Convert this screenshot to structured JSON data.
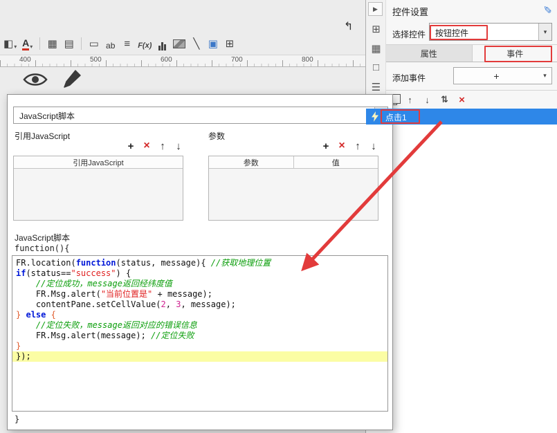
{
  "colors": {
    "accent_blue": "#2e87e8",
    "annotation_red": "#e23b3b",
    "highlight_yellow": "#fbfda4",
    "keyword_blue": "#0018d8",
    "string_red": "#e02020",
    "comment_green": "#0b9e0b"
  },
  "icons": {
    "caret_down": "▾",
    "collapse": "▶",
    "edit_pencil": "✎",
    "return_arrow": "↰"
  },
  "top_toolbar": {
    "icons": [
      {
        "name": "fill-color-icon",
        "glyph": "◧",
        "caret": true
      },
      {
        "name": "font-color-icon",
        "label": "A",
        "cls": "tb-fontA",
        "caret": true
      },
      {
        "name": "toolbar-separator",
        "type": "sep"
      },
      {
        "name": "merge-cell-icon",
        "glyph": "▦"
      },
      {
        "name": "unmerge-cell-icon",
        "glyph": "▤"
      },
      {
        "name": "toolbar-separator",
        "type": "sep"
      },
      {
        "name": "text-field-icon",
        "glyph": "▭"
      },
      {
        "name": "text-ab-icon",
        "label": "ab",
        "cls": "tb-ab"
      },
      {
        "name": "align-icon",
        "glyph": "≡"
      },
      {
        "name": "formula-icon",
        "label": "F(x)",
        "cls": "tb-fx"
      },
      {
        "name": "chart-icon",
        "type": "bars"
      },
      {
        "name": "image-icon",
        "type": "pic"
      },
      {
        "name": "line-icon",
        "glyph": "╲"
      },
      {
        "name": "panel-icon",
        "glyph": "▣",
        "cls": "tb-blue"
      },
      {
        "name": "widget-icon",
        "glyph": "⊞"
      }
    ]
  },
  "ruler": {
    "marks": [
      "400",
      "500",
      "600",
      "700",
      "800"
    ]
  },
  "dialog": {
    "type_value": "JavaScript脚本",
    "ref_label": "引用JavaScript",
    "param_label": "参数",
    "ref_table_header": "引用JavaScript",
    "param_col_name": "参数",
    "param_col_value": "值",
    "script_label": "JavaScript脚本",
    "func_open": "function(){",
    "func_close": "}",
    "toolbar_buttons": [
      {
        "name": "add-button",
        "glyph": "+"
      },
      {
        "name": "delete-button",
        "glyph": "×",
        "cls": "red"
      },
      {
        "name": "move-up-button",
        "glyph": "↑"
      },
      {
        "name": "move-down-button",
        "glyph": "↓"
      }
    ],
    "code_lines": [
      {
        "tokens": [
          {
            "t": "FR.location(",
            "c": "pl"
          },
          {
            "t": "function",
            "c": "kw"
          },
          {
            "t": "(status, message){ ",
            "c": "pl"
          },
          {
            "t": "//获取地理位置",
            "c": "cm"
          }
        ]
      },
      {
        "tokens": [
          {
            "t": "if",
            "c": "kw"
          },
          {
            "t": "(status==",
            "c": "pl"
          },
          {
            "t": "\"success\"",
            "c": "st"
          },
          {
            "t": ") {",
            "c": "pl"
          }
        ]
      },
      {
        "tokens": [
          {
            "t": "    ",
            "c": "pl"
          },
          {
            "t": "//定位成功，message返回经纬度值",
            "c": "cm"
          }
        ]
      },
      {
        "tokens": [
          {
            "t": "    FR.Msg.alert(",
            "c": "pl"
          },
          {
            "t": "\"当前位置是\"",
            "c": "st"
          },
          {
            "t": " + message);",
            "c": "pl"
          }
        ]
      },
      {
        "tokens": [
          {
            "t": "    contentPane.setCellValue(",
            "c": "pl"
          },
          {
            "t": "2",
            "c": "nm"
          },
          {
            "t": ", ",
            "c": "pl"
          },
          {
            "t": "3",
            "c": "nm"
          },
          {
            "t": ", message);",
            "c": "pl"
          }
        ]
      },
      {
        "tokens": [
          {
            "t": "}",
            "c": "br"
          },
          {
            "t": " ",
            "c": "pl"
          },
          {
            "t": "else",
            "c": "kw"
          },
          {
            "t": " ",
            "c": "pl"
          },
          {
            "t": "{",
            "c": "br"
          }
        ]
      },
      {
        "tokens": [
          {
            "t": "    ",
            "c": "pl"
          },
          {
            "t": "//定位失败，message返回对应的错误信息",
            "c": "cm"
          }
        ]
      },
      {
        "tokens": [
          {
            "t": "    FR.Msg.alert(message); ",
            "c": "pl"
          },
          {
            "t": "//定位失败",
            "c": "cm"
          }
        ]
      },
      {
        "tokens": [
          {
            "t": "}",
            "c": "br"
          }
        ]
      },
      {
        "hl": true,
        "tokens": [
          {
            "t": "});",
            "c": "pl"
          }
        ]
      }
    ]
  },
  "right_panel": {
    "title": "控件设置",
    "select_label": "选择控件",
    "select_value": "按钮控件",
    "tabs": [
      "属性",
      "事件"
    ],
    "add_event_label": "添加事件",
    "add_event_plus": "+",
    "event_item": "点击1",
    "strip_icons": [
      {
        "name": "widget-settings-tab-icon",
        "glyph": "⊞"
      },
      {
        "name": "cell-attribute-tab-icon",
        "glyph": "▦"
      },
      {
        "name": "cell-element-tab-icon",
        "glyph": "□"
      },
      {
        "name": "float-element-tab-icon",
        "glyph": "☰"
      }
    ],
    "event_toolbar": [
      {
        "name": "copy-icon",
        "type": "copy"
      },
      {
        "name": "move-up-icon",
        "glyph": "↑"
      },
      {
        "name": "move-down-icon",
        "glyph": "↓"
      },
      {
        "name": "sort-icon",
        "glyph": "⇅"
      },
      {
        "name": "delete-icon",
        "glyph": "×",
        "cls": "red"
      }
    ]
  }
}
